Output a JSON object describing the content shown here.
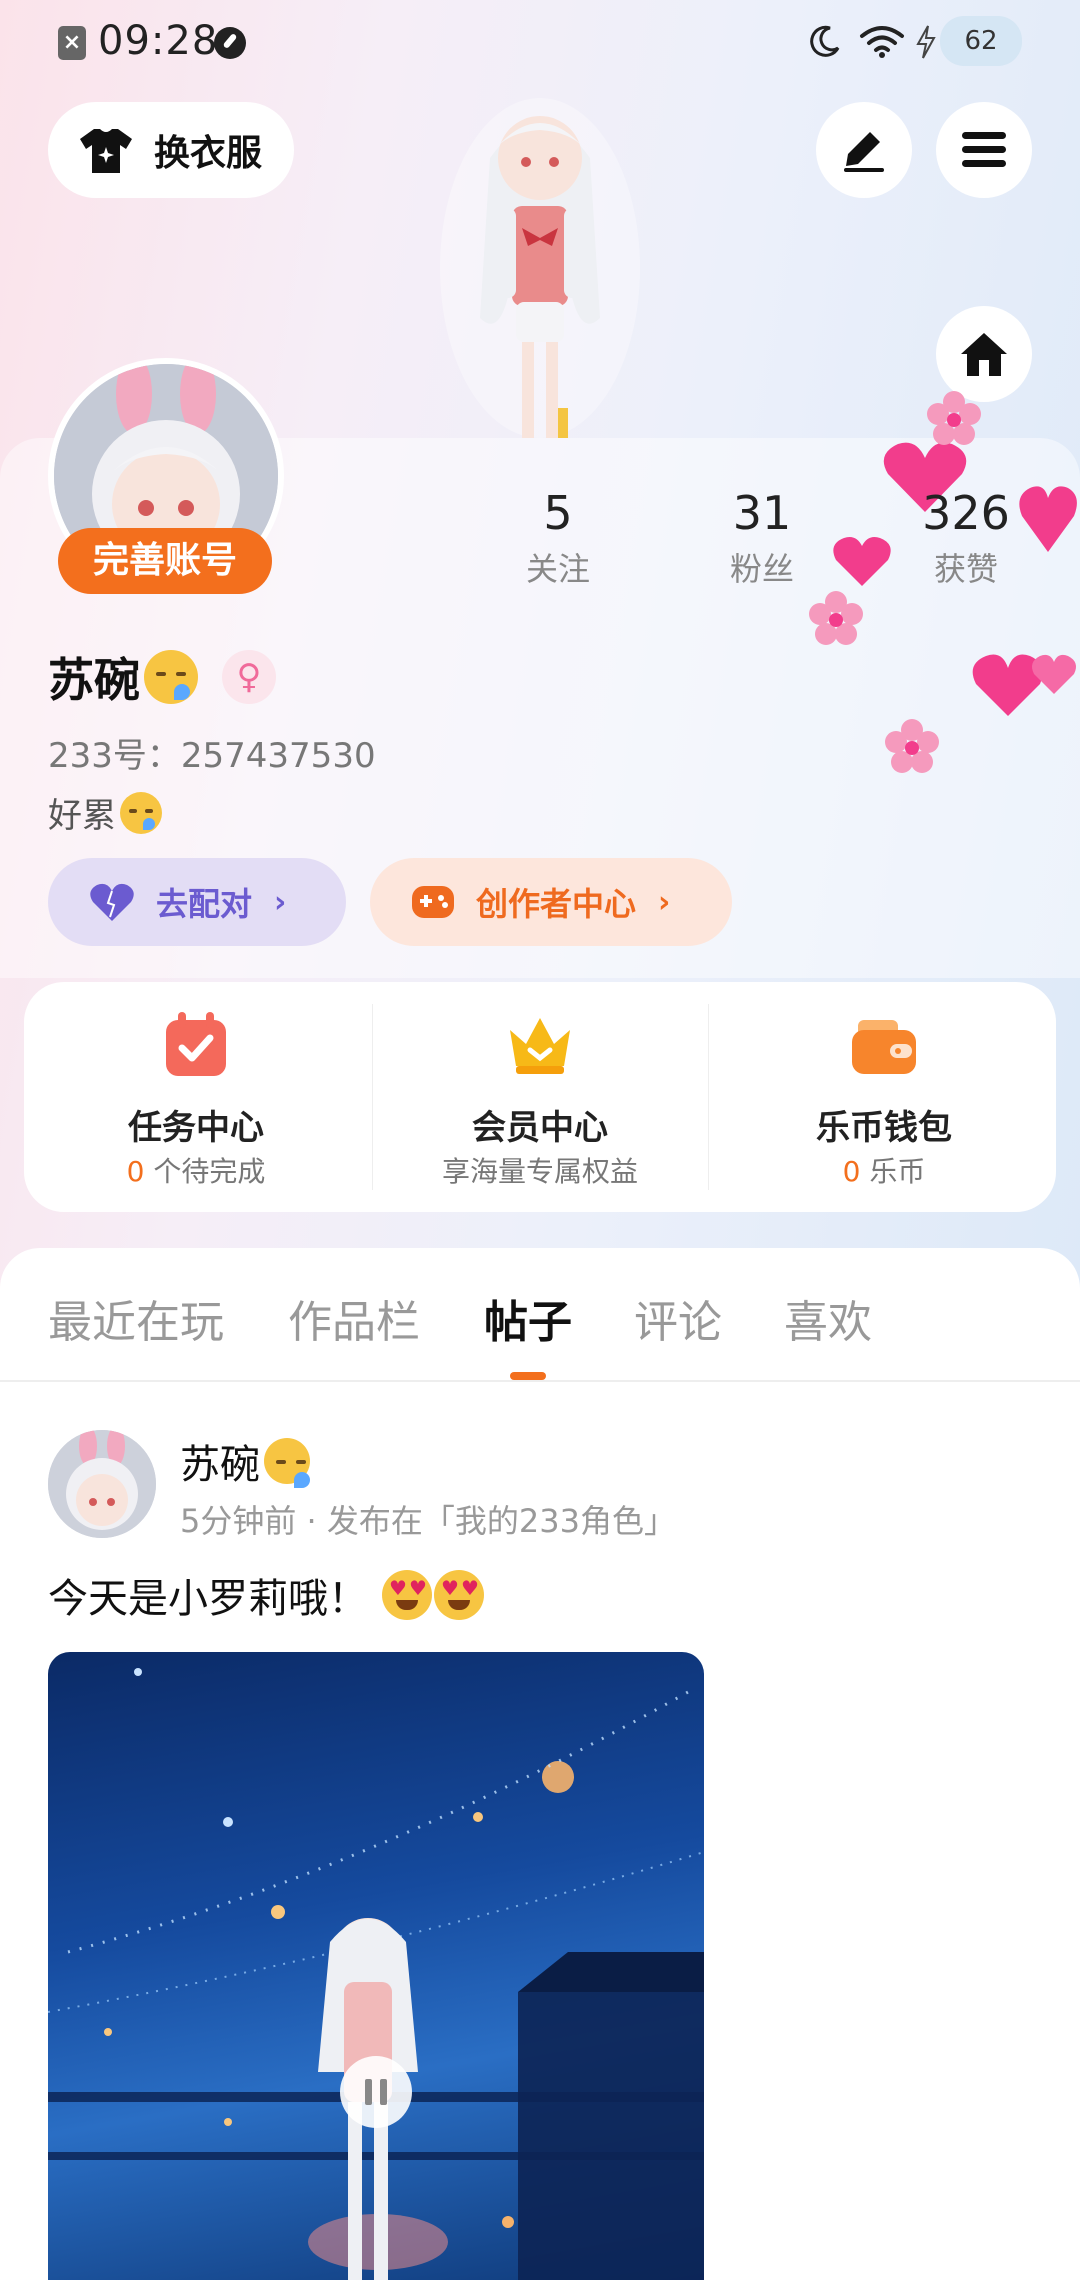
{
  "status_bar": {
    "time": "09:28",
    "battery": "62"
  },
  "top_actions": {
    "dress_up_label": "换衣服"
  },
  "profile": {
    "complete_account_label": "完善账号",
    "name": "苏碗",
    "uid": "233号：257437530",
    "bio": "好累",
    "stats": [
      {
        "value": "5",
        "label": "关注"
      },
      {
        "value": "31",
        "label": "粉丝"
      },
      {
        "value": "326",
        "label": "获赞"
      }
    ],
    "pair_label": "去配对",
    "creator_label": "创作者中心"
  },
  "features": {
    "task": {
      "title": "任务中心",
      "count": "0",
      "sub": " 个待完成"
    },
    "vip": {
      "title": "会员中心",
      "sub": "享海量专属权益"
    },
    "wallet": {
      "title": "乐币钱包",
      "count": "0",
      "sub": " 乐币"
    }
  },
  "tabs": [
    "最近在玩",
    "作品栏",
    "帖子",
    "评论",
    "喜欢"
  ],
  "active_tab": "帖子",
  "post": {
    "author": "苏碗",
    "meta": "5分钟前 · 发布在「我的233角色」",
    "text": "今天是小罗莉哦！"
  },
  "colors": {
    "accent": "#f36f1d",
    "pair": "#6b5bd0",
    "creator": "#ef6a1f"
  }
}
